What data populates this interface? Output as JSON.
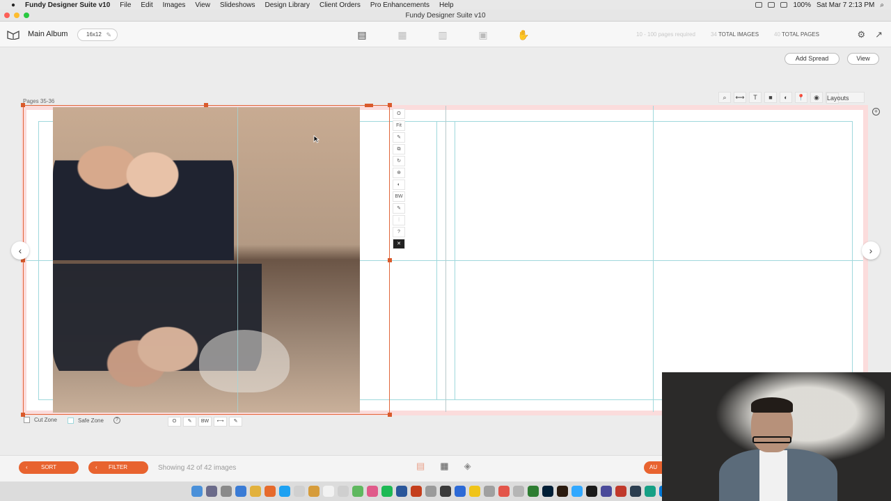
{
  "menubar": {
    "app_name": "Fundy Designer Suite v10",
    "items": [
      "File",
      "Edit",
      "Images",
      "View",
      "Slideshows",
      "Design Library",
      "Client Orders",
      "Pro Enhancements",
      "Help"
    ],
    "battery": "100%",
    "clock": "Sat Mar 7  2:13 PM"
  },
  "window": {
    "title": "Fundy Designer Suite v10"
  },
  "toolbar": {
    "album_name": "Main Album",
    "album_size": "16x12",
    "pages_required": "10 - 100 pages required",
    "total_images_count": "34",
    "total_images_label": "TOTAL IMAGES",
    "total_pages_count": "40",
    "total_pages_label": "TOTAL PAGES",
    "add_spread_label": "Add Spread",
    "view_label": "View"
  },
  "spread": {
    "pages_label": "Pages 35-36",
    "layouts_label": "Layouts",
    "image_tools": [
      "O",
      "Fit",
      "✎",
      "⧉",
      "↻",
      "⊕",
      "◐",
      "BW",
      "✎",
      "⫶",
      "?",
      "✕"
    ],
    "cut_zone_label": "Cut Zone",
    "safe_zone_label": "Safe Zone",
    "mini_tools": [
      "O",
      "✎",
      "BW",
      "⟷",
      "✎"
    ]
  },
  "bottom": {
    "sort_label": "SORT",
    "filter_label": "FILTER",
    "showing_text": "Showing 42 of 42 images",
    "auto_label": "AU"
  },
  "colors": {
    "accent": "#e8632f",
    "guide": "#9fd8dc",
    "bleed": "#fbdcdc"
  }
}
